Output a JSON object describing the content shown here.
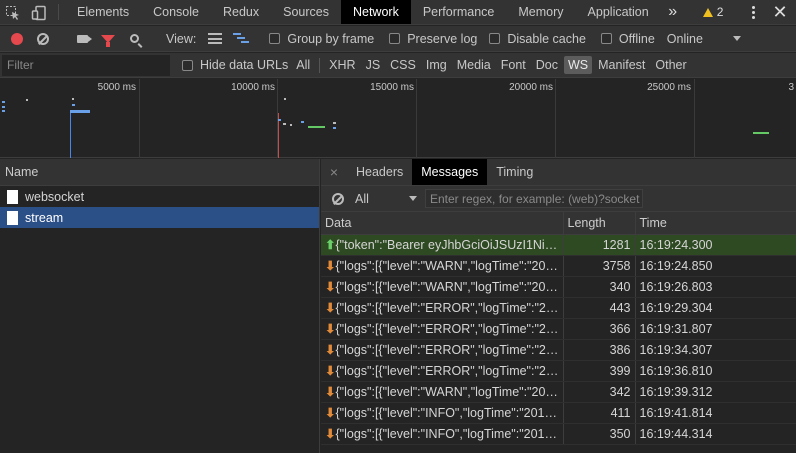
{
  "tabs": [
    "Elements",
    "Console",
    "Redux",
    "Sources",
    "Network",
    "Performance",
    "Memory",
    "Application"
  ],
  "active_tab": "Network",
  "warning_count": "2",
  "toolbar": {
    "view_label": "View:",
    "group_by_frame": "Group by frame",
    "preserve_log": "Preserve log",
    "disable_cache": "Disable cache",
    "offline": "Offline",
    "throttle": "Online"
  },
  "filter": {
    "placeholder": "Filter",
    "hide_data_urls": "Hide data URLs",
    "types": [
      "All",
      "XHR",
      "JS",
      "CSS",
      "Img",
      "Media",
      "Font",
      "Doc",
      "WS",
      "Manifest",
      "Other"
    ],
    "active_type": "WS"
  },
  "overview": {
    "labels": [
      "5000 ms",
      "10000 ms",
      "15000 ms",
      "20000 ms",
      "25000 ms",
      "3"
    ]
  },
  "requests": {
    "header": "Name",
    "items": [
      "websocket",
      "stream"
    ],
    "selected": "stream"
  },
  "detail": {
    "close": "×",
    "tabs": [
      "Headers",
      "Messages",
      "Timing"
    ],
    "active_tab": "Messages",
    "message_filter": "All",
    "regex_placeholder": "Enter regex, for example: (web)?socket",
    "columns": [
      "Data",
      "Length",
      "Time"
    ],
    "messages": [
      {
        "dir": "up",
        "data": "{\"token\":\"Bearer eyJhbGciOiJSUzI1NiIs…",
        "length": "1281",
        "time": "16:19:24.300"
      },
      {
        "dir": "down",
        "data": "{\"logs\":[{\"level\":\"WARN\",\"logTime\":\"201…",
        "length": "3758",
        "time": "16:19:24.850"
      },
      {
        "dir": "down",
        "data": "{\"logs\":[{\"level\":\"WARN\",\"logTime\":\"201…",
        "length": "340",
        "time": "16:19:26.803"
      },
      {
        "dir": "down",
        "data": "{\"logs\":[{\"level\":\"ERROR\",\"logTime\":\"20…",
        "length": "443",
        "time": "16:19:29.304"
      },
      {
        "dir": "down",
        "data": "{\"logs\":[{\"level\":\"ERROR\",\"logTime\":\"20…",
        "length": "366",
        "time": "16:19:31.807"
      },
      {
        "dir": "down",
        "data": "{\"logs\":[{\"level\":\"ERROR\",\"logTime\":\"20…",
        "length": "386",
        "time": "16:19:34.307"
      },
      {
        "dir": "down",
        "data": "{\"logs\":[{\"level\":\"ERROR\",\"logTime\":\"20…",
        "length": "399",
        "time": "16:19:36.810"
      },
      {
        "dir": "down",
        "data": "{\"logs\":[{\"level\":\"WARN\",\"logTime\":\"201…",
        "length": "342",
        "time": "16:19:39.312"
      },
      {
        "dir": "down",
        "data": "{\"logs\":[{\"level\":\"INFO\",\"logTime\":\"2019…",
        "length": "411",
        "time": "16:19:41.814"
      },
      {
        "dir": "down",
        "data": "{\"logs\":[{\"level\":\"INFO\",\"logTime\":\"2019…",
        "length": "350",
        "time": "16:19:44.314"
      }
    ]
  },
  "colors": {
    "record": "#e5484d",
    "sent_row": "#2e4a22",
    "selected_row": "#2b4f87",
    "up_arrow": "#6ad06a",
    "down_arrow": "#e08a3a"
  }
}
